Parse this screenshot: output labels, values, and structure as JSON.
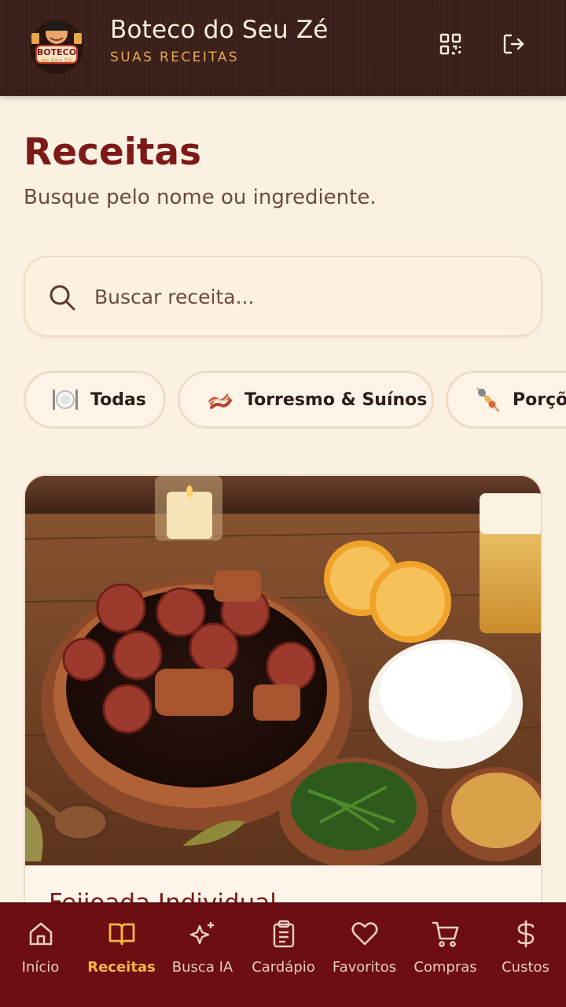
{
  "header": {
    "title": "Boteco do Seu Zé",
    "subtitle": "SUAS RECEITAS",
    "logo_text": "BOTECO do Seu Zé",
    "icons": [
      "qr-code-icon",
      "logout-icon"
    ]
  },
  "page": {
    "title": "Receitas",
    "subtitle": "Busque pelo nome ou ingrediente."
  },
  "search": {
    "placeholder": "Buscar receita...",
    "value": ""
  },
  "categories": [
    {
      "label": "Todas",
      "icon": "plate-cutlery-icon"
    },
    {
      "label": "Torresmo & Suínos",
      "icon": "bacon-icon"
    },
    {
      "label": "Porções",
      "icon": "skewer-icon"
    }
  ],
  "recipes": [
    {
      "title": "Feijoada Individual",
      "image": "feijoada-photo"
    }
  ],
  "nav": [
    {
      "label": "Início",
      "icon": "home-icon",
      "active": false
    },
    {
      "label": "Receitas",
      "icon": "book-icon",
      "active": true
    },
    {
      "label": "Busca IA",
      "icon": "sparkles-icon",
      "active": false
    },
    {
      "label": "Cardápio",
      "icon": "clipboard-icon",
      "active": false
    },
    {
      "label": "Favoritos",
      "icon": "heart-icon",
      "active": false
    },
    {
      "label": "Compras",
      "icon": "cart-icon",
      "active": false
    },
    {
      "label": "Custos",
      "icon": "dollar-icon",
      "active": false
    }
  ],
  "colors": {
    "header_bg": "#3a1f1a",
    "accent_gold": "#e7a84a",
    "title_red": "#7d1a17",
    "nav_bg": "#6d0e12",
    "nav_active": "#f4b546",
    "page_bg": "#fbf1e3"
  }
}
